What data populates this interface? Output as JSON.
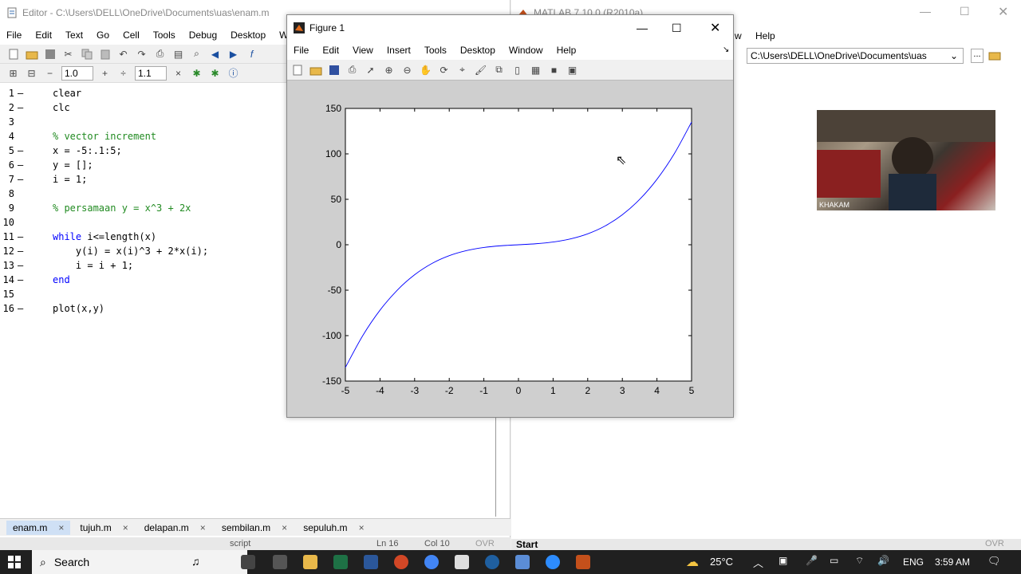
{
  "editor": {
    "title": "Editor - C:\\Users\\DELL\\OneDrive\\Documents\\uas\\enam.m",
    "menu": [
      "File",
      "Edit",
      "Text",
      "Go",
      "Cell",
      "Tools",
      "Debug",
      "Desktop",
      "Wi"
    ],
    "toolbar2": {
      "field1": "1.0",
      "field2": "1.1",
      "minus": "−",
      "plus": "+",
      "div": "÷",
      "times": "×"
    },
    "lines": [
      {
        "n": "1",
        "dash": "–",
        "text": "clear",
        "kind": "plain"
      },
      {
        "n": "2",
        "dash": "–",
        "text": "clc",
        "kind": "plain"
      },
      {
        "n": "3",
        "dash": "",
        "text": "",
        "kind": "plain"
      },
      {
        "n": "4",
        "dash": "",
        "text": "% vector increment",
        "kind": "comment"
      },
      {
        "n": "5",
        "dash": "–",
        "text": "x = -5:.1:5;",
        "kind": "plain"
      },
      {
        "n": "6",
        "dash": "–",
        "text": "y = [];",
        "kind": "plain"
      },
      {
        "n": "7",
        "dash": "–",
        "text": "i = 1;",
        "kind": "plain"
      },
      {
        "n": "8",
        "dash": "",
        "text": "",
        "kind": "plain"
      },
      {
        "n": "9",
        "dash": "",
        "text": "% persamaan y = x^3 + 2x",
        "kind": "comment"
      },
      {
        "n": "10",
        "dash": "",
        "text": "",
        "kind": "plain"
      },
      {
        "n": "11",
        "dash": "–",
        "text": "while i<=length(x)",
        "kind": "while"
      },
      {
        "n": "12",
        "dash": "–",
        "text": "    y(i) = x(i)^3 + 2*x(i);",
        "kind": "plain"
      },
      {
        "n": "13",
        "dash": "–",
        "text": "    i = i + 1;",
        "kind": "plain"
      },
      {
        "n": "14",
        "dash": "–",
        "text": "end",
        "kind": "keyword"
      },
      {
        "n": "15",
        "dash": "",
        "text": "",
        "kind": "plain"
      },
      {
        "n": "16",
        "dash": "–",
        "text": "plot(x,y)",
        "kind": "plain"
      }
    ],
    "tabs": [
      {
        "label": "enam.m",
        "active": true
      },
      {
        "label": "tujuh.m",
        "active": false
      },
      {
        "label": "delapan.m",
        "active": false
      },
      {
        "label": "sembilan.m",
        "active": false
      },
      {
        "label": "sepuluh.m",
        "active": false
      }
    ],
    "status": {
      "mode": "script",
      "ln": "Ln  16",
      "col": "Col  10",
      "ovr": "OVR"
    }
  },
  "matlab": {
    "title": "MATLAB  7.10.0 (R2010a)",
    "menu_help": "Help",
    "menu_w": "w",
    "path": "C:\\Users\\DELL\\OneDrive\\Documents\\uas",
    "path_btn": "...",
    "start": "Start",
    "ovr": "OVR",
    "camera_name": "KHAKAM"
  },
  "figure": {
    "title": "Figure 1",
    "menu": [
      "File",
      "Edit",
      "View",
      "Insert",
      "Tools",
      "Desktop",
      "Window",
      "Help"
    ]
  },
  "chart_data": {
    "type": "line",
    "title": "",
    "xlabel": "",
    "ylabel": "",
    "xlim": [
      -5,
      5
    ],
    "ylim": [
      -150,
      150
    ],
    "xticks": [
      -5,
      -4,
      -3,
      -2,
      -1,
      0,
      1,
      2,
      3,
      4,
      5
    ],
    "yticks": [
      150,
      100,
      50,
      0,
      -50,
      -100,
      -150
    ],
    "grid": false,
    "series": [
      {
        "color": "#0000ff",
        "x": [
          -5,
          -4.5,
          -4,
          -3.5,
          -3,
          -2.5,
          -2,
          -1.5,
          -1,
          -0.5,
          0,
          0.5,
          1,
          1.5,
          2,
          2.5,
          3,
          3.5,
          4,
          4.5,
          5
        ],
        "y": [
          -135,
          -100.1,
          -72,
          -49.9,
          -33,
          -20.6,
          -12,
          -6.4,
          -3,
          -1.1,
          0,
          1.1,
          3,
          6.4,
          12,
          20.6,
          33,
          49.9,
          72,
          100.1,
          135
        ]
      }
    ]
  },
  "taskbar": {
    "search": "Search",
    "temp": "25°C",
    "lang": "ENG",
    "time": "3:59 AM"
  }
}
